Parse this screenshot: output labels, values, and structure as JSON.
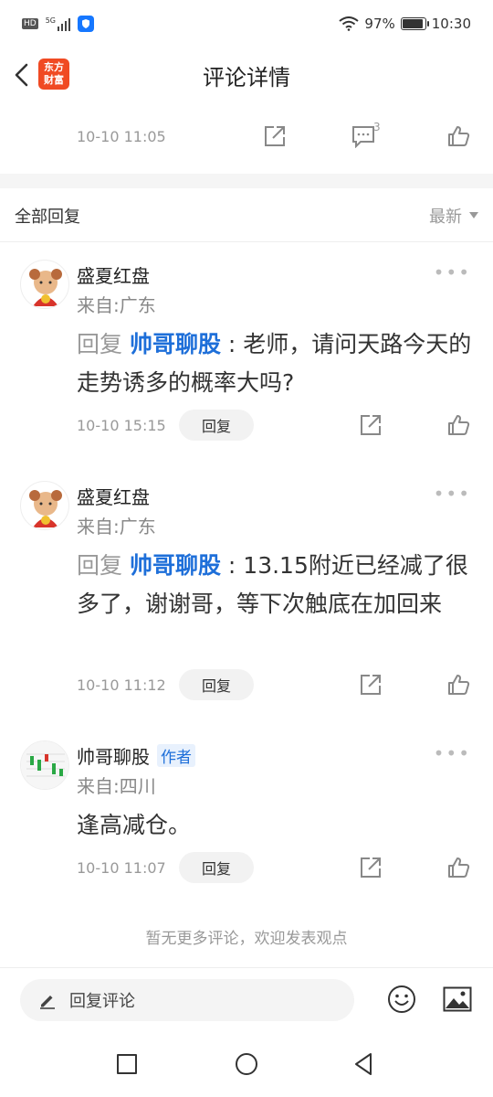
{
  "status_bar": {
    "hd": "HD",
    "network": "5G",
    "battery": "97%",
    "time": "10:30"
  },
  "nav": {
    "logo_text_line1": "东方",
    "logo_text_line2": "财富",
    "title": "评论详情"
  },
  "previous_item": {
    "time": "10-10 11:05",
    "comment_count": "3"
  },
  "replies_header": {
    "label": "全部回复",
    "sort_label": "最新"
  },
  "comments": [
    {
      "user": "盛夏红盘",
      "location": "来自:广东",
      "reply_prefix": "回复 ",
      "reply_to": "帅哥聊股",
      "text": " : 老师，请问天路今天的走势诱多的概率大吗?",
      "time": "10-10 15:15",
      "reply_label": "回复"
    },
    {
      "user": "盛夏红盘",
      "location": "来自:广东",
      "reply_prefix": "回复 ",
      "reply_to": "帅哥聊股",
      "text": " : 13.15附近已经减了很多了，谢谢哥，等下次触底在加回来",
      "time": "10-10 11:12",
      "reply_label": "回复"
    },
    {
      "user": "帅哥聊股",
      "author_tag": "作者",
      "location": "来自:四川",
      "text": "逢高减仓。",
      "time": "10-10 11:07",
      "reply_label": "回复"
    }
  ],
  "footer_note": "暂无更多评论，欢迎发表观点",
  "input_bar": {
    "placeholder": "回复评论"
  },
  "colors": {
    "link_blue": "#1e6fd9",
    "brand_orange": "#f04a23"
  }
}
